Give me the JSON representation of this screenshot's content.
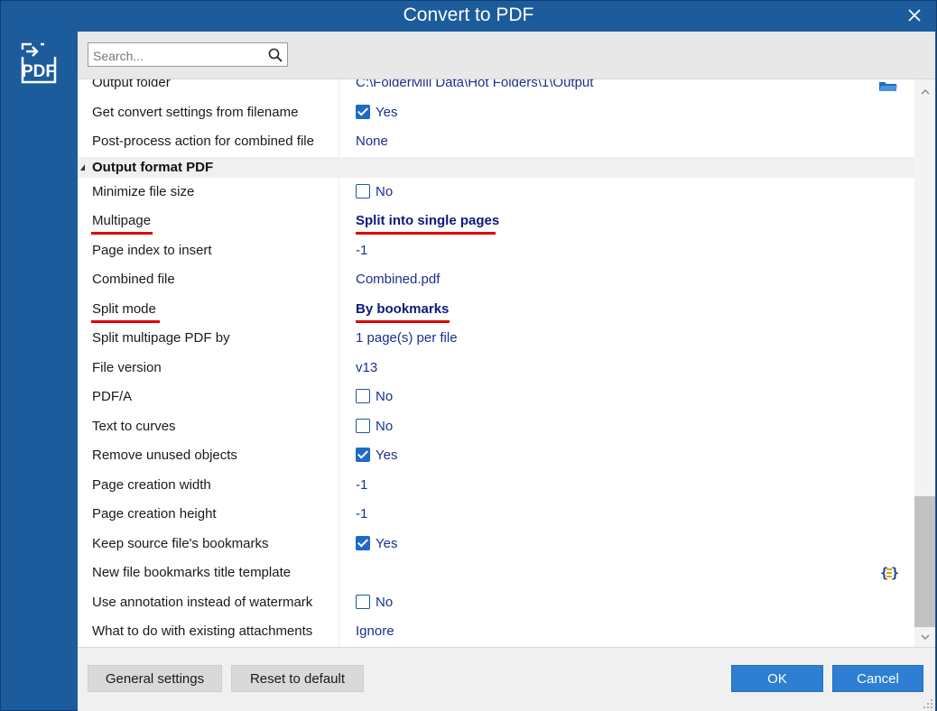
{
  "window": {
    "title": "Convert to PDF",
    "close_glyph": "✕"
  },
  "sidebar": {
    "logo_icon": "pdf-convert-icon",
    "logo_text": "PDF"
  },
  "search": {
    "placeholder": "Search...",
    "value": ""
  },
  "colors": {
    "frame": "#1c5c9c",
    "value_text": "#1b2f8f",
    "highlight_underline": "#e00000",
    "checkbox_on": "#1e6bc6",
    "primary_button": "#2e7fd3"
  },
  "rows_top": [
    {
      "label": "Output folder",
      "value": "C:\\FolderMill Data\\Hot Folders\\1\\Output",
      "icon": "folder-icon"
    },
    {
      "label": "Get convert settings from filename",
      "value": "Yes",
      "checkbox": true
    },
    {
      "label": "Post-process action for combined file",
      "value": "None"
    }
  ],
  "section": {
    "label": "Output format PDF"
  },
  "rows": [
    {
      "label": "Minimize file size",
      "value": "No",
      "checkbox": false
    },
    {
      "label": "Multipage",
      "value": "Split into single pages",
      "highlighted": true
    },
    {
      "label": "Page index to insert",
      "value": "-1"
    },
    {
      "label": "Combined file",
      "value": "Combined.pdf"
    },
    {
      "label": "Split mode",
      "value": "By bookmarks",
      "highlighted": true
    },
    {
      "label": "Split multipage PDF by",
      "value": "1 page(s) per file"
    },
    {
      "label": "File version",
      "value": "v13"
    },
    {
      "label": "PDF/A",
      "value": "No",
      "checkbox": false
    },
    {
      "label": "Text to curves",
      "value": "No",
      "checkbox": false
    },
    {
      "label": "Remove unused objects",
      "value": "Yes",
      "checkbox": true
    },
    {
      "label": "Page creation width",
      "value": "-1"
    },
    {
      "label": "Page creation height",
      "value": "-1"
    },
    {
      "label": "Keep source file's bookmarks",
      "value": "Yes",
      "checkbox": true
    },
    {
      "label": "New file bookmarks title template",
      "value": "",
      "icon": "template-macro-icon"
    },
    {
      "label": "Use annotation instead of watermark",
      "value": "No",
      "checkbox": false
    },
    {
      "label": "What to do with existing attachments",
      "value": "Ignore"
    }
  ],
  "footer": {
    "general_settings_label": "General settings",
    "reset_label": "Reset to default",
    "ok_label": "OK",
    "cancel_label": "Cancel"
  }
}
